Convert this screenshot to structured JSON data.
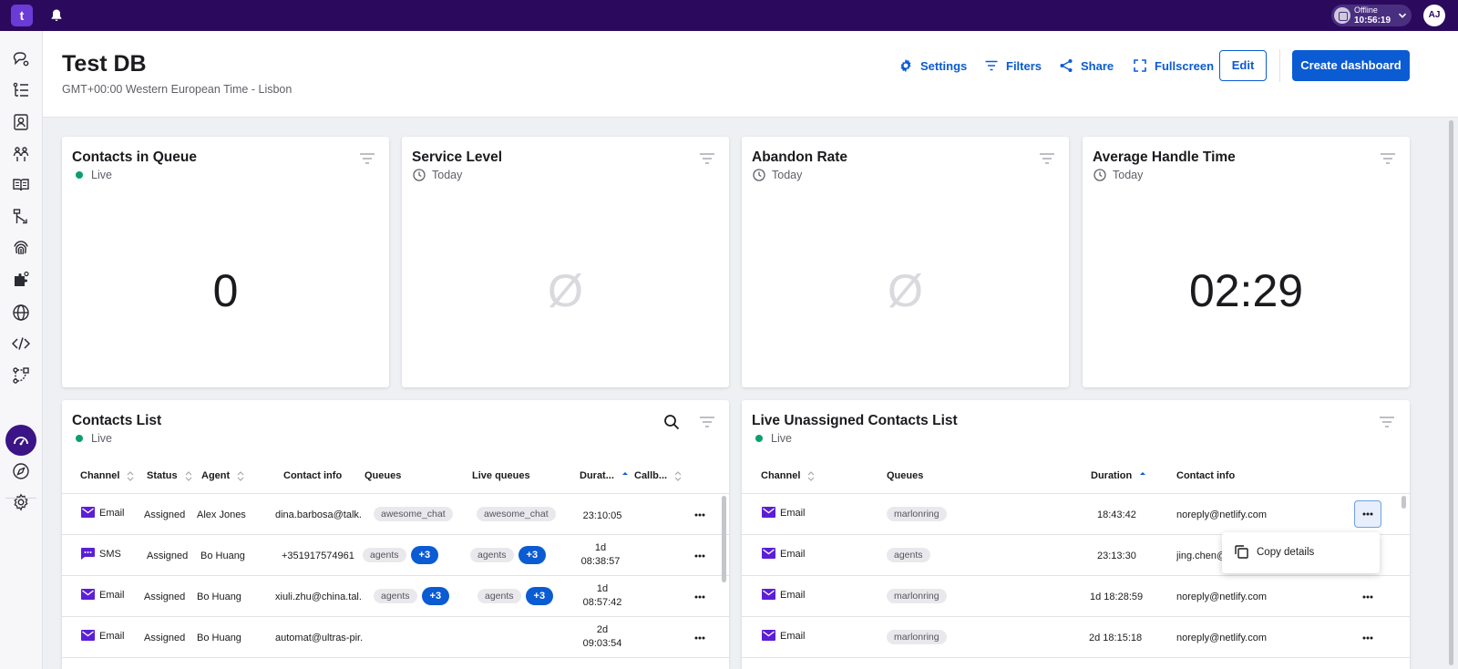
{
  "topbar": {
    "logo_text": "t",
    "status_label": "Offline",
    "status_time": "10:56:19",
    "avatar_initials": "AJ"
  },
  "sidebar": {
    "items": [
      "inbox-icon",
      "tasks-icon",
      "contacts-icon",
      "teams-icon",
      "knowledge-icon",
      "flows-icon",
      "fingerprint-icon",
      "integrations-icon",
      "globe-icon",
      "code-icon",
      "workflow-icon",
      "dashboard-icon",
      "compass-icon",
      "settings-icon"
    ],
    "active_item": "dashboard-icon"
  },
  "header": {
    "title": "Test DB",
    "subtitle": "GMT+00:00 Western European Time - Lisbon",
    "settings_label": "Settings",
    "filters_label": "Filters",
    "share_label": "Share",
    "fullscreen_label": "Fullscreen",
    "edit_label": "Edit",
    "create_label": "Create dashboard"
  },
  "metrics": [
    {
      "title": "Contacts in Queue",
      "period": "Live",
      "value": "0",
      "has_value": true
    },
    {
      "title": "Service Level",
      "period": "Today",
      "value": "Ø",
      "has_value": false
    },
    {
      "title": "Abandon Rate",
      "period": "Today",
      "value": "Ø",
      "has_value": false
    },
    {
      "title": "Average Handle Time",
      "period": "Today",
      "value": "02:29",
      "has_value": true
    }
  ],
  "contacts_list": {
    "title": "Contacts List",
    "period": "Live",
    "columns": [
      "Channel",
      "Status",
      "Agent",
      "Contact info",
      "Queues",
      "Live queues",
      "Durat...",
      "Callb..."
    ],
    "rows": [
      {
        "channel": "Email",
        "status": "Assigned",
        "agent": "Alex Jones",
        "contact": "dina.barbosa@talk...",
        "queue": "awesome_chat",
        "queue_more": "",
        "live_queue": "awesome_chat",
        "live_more": "",
        "duration_1": "23:10:05",
        "duration_2": ""
      },
      {
        "channel": "SMS",
        "status": "Assigned",
        "agent": "Bo Huang",
        "contact": "+351917574961",
        "queue": "agents",
        "queue_more": "+3",
        "live_queue": "agents",
        "live_more": "+3",
        "duration_1": "1d",
        "duration_2": "08:38:57"
      },
      {
        "channel": "Email",
        "status": "Assigned",
        "agent": "Bo Huang",
        "contact": "xiuli.zhu@china.tal...",
        "queue": "agents",
        "queue_more": "+3",
        "live_queue": "agents",
        "live_more": "+3",
        "duration_1": "1d",
        "duration_2": "08:57:42"
      },
      {
        "channel": "Email",
        "status": "Assigned",
        "agent": "Bo Huang",
        "contact": "automat@ultras-pir...",
        "queue": "",
        "queue_more": "",
        "live_queue": "",
        "live_more": "",
        "duration_1": "2d",
        "duration_2": "09:03:54"
      }
    ]
  },
  "unassigned_list": {
    "title": "Live Unassigned Contacts List",
    "period": "Live",
    "columns": [
      "Channel",
      "Queues",
      "Duration",
      "Contact info"
    ],
    "rows": [
      {
        "channel": "Email",
        "queue": "marlonring",
        "duration": "18:43:42",
        "contact": "noreply@netlify.com"
      },
      {
        "channel": "Email",
        "queue": "agents",
        "duration": "23:13:30",
        "contact": "jing.chen@"
      },
      {
        "channel": "Email",
        "queue": "marlonring",
        "duration": "1d 18:28:59",
        "contact": "noreply@netlify.com"
      },
      {
        "channel": "Email",
        "queue": "marlonring",
        "duration": "2d 18:15:18",
        "contact": "noreply@netlify.com"
      }
    ]
  },
  "context_menu": {
    "item_label": "Copy details"
  },
  "colors": {
    "topbar": "#2b0a5e",
    "primary": "#0b5bd3",
    "live": "#0aa06e",
    "channel_icon": "#5b1fd6"
  }
}
